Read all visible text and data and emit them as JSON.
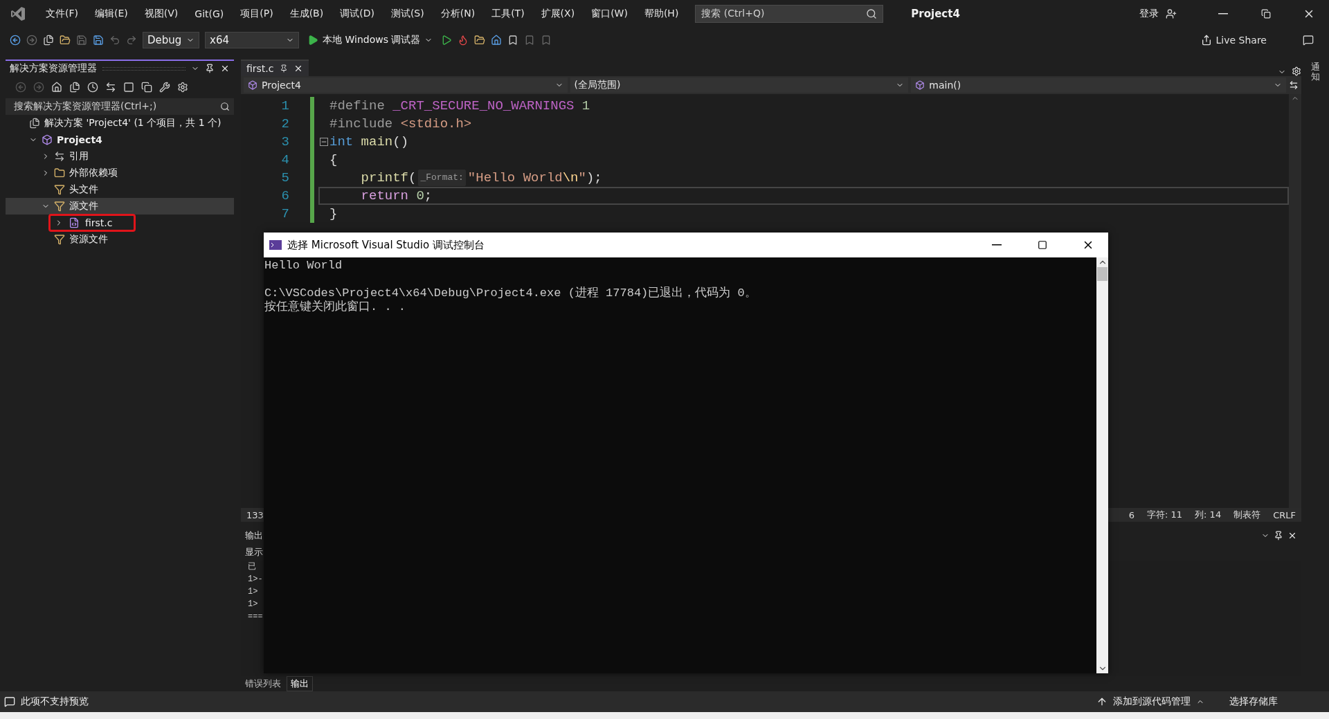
{
  "menu": [
    "文件(F)",
    "编辑(E)",
    "视图(V)",
    "Git(G)",
    "项目(P)",
    "生成(B)",
    "调试(D)",
    "测试(S)",
    "分析(N)",
    "工具(T)",
    "扩展(X)",
    "窗口(W)",
    "帮助(H)"
  ],
  "search": {
    "placeholder": "搜索 (Ctrl+Q)"
  },
  "window": {
    "title": "Project4"
  },
  "account": {
    "label": "登录"
  },
  "toolbar": {
    "configuration": "Debug",
    "platform": "x64",
    "run_label": "本地 Windows 调试器",
    "live_share": "Live Share"
  },
  "solution_explorer": {
    "title": "解决方案资源管理器",
    "search_placeholder": "搜索解决方案资源管理器(Ctrl+;)",
    "tree": [
      {
        "label": "解决方案 'Project4' (1 个项目，共 1 个)",
        "kind": "solution",
        "expandable": false,
        "selected": false,
        "annotated": false,
        "children": [
          {
            "label": "Project4",
            "kind": "project",
            "expandable": true,
            "expanded": true,
            "selected": false,
            "annotated": false,
            "children": [
              {
                "label": "引用",
                "kind": "references",
                "expandable": true,
                "expanded": false,
                "selected": false,
                "annotated": false
              },
              {
                "label": "外部依赖项",
                "kind": "dependencies",
                "expandable": true,
                "expanded": false,
                "selected": false,
                "annotated": false
              },
              {
                "label": "头文件",
                "kind": "filter",
                "expandable": false,
                "selected": false,
                "annotated": false
              },
              {
                "label": "源文件",
                "kind": "filter",
                "expandable": true,
                "expanded": true,
                "selected": true,
                "annotated": false,
                "children": [
                  {
                    "label": "first.c",
                    "kind": "file",
                    "expandable": true,
                    "expanded": false,
                    "selected": false,
                    "annotated": true
                  }
                ]
              },
              {
                "label": "资源文件",
                "kind": "filter",
                "expandable": false,
                "selected": false,
                "annotated": false
              }
            ]
          }
        ]
      }
    ]
  },
  "editor": {
    "tabs": [
      {
        "label": "first.c",
        "selected": true
      }
    ],
    "nav": {
      "project": "Project4",
      "scope": "(全局范围)",
      "member": "main()"
    },
    "lines": [
      {
        "number": "1",
        "fold": false,
        "current": false,
        "tokens": [
          {
            "t": "#define ",
            "kind": "directive"
          },
          {
            "t": "_CRT_SECURE_NO_WARNINGS",
            "kind": "macro"
          },
          {
            "t": " 1",
            "kind": "number"
          }
        ]
      },
      {
        "number": "2",
        "fold": false,
        "current": false,
        "tokens": [
          {
            "t": "#include ",
            "kind": "directive"
          },
          {
            "t": "<stdio.h>",
            "kind": "string"
          }
        ]
      },
      {
        "number": "3",
        "fold": true,
        "current": false,
        "tokens": [
          {
            "t": "int",
            "kind": "keyword"
          },
          {
            "t": " main",
            "kind": "function"
          },
          {
            "t": "()",
            "kind": "plain"
          }
        ]
      },
      {
        "number": "4",
        "fold": false,
        "current": false,
        "tokens": [
          {
            "t": "{",
            "kind": "plain"
          }
        ]
      },
      {
        "number": "5",
        "fold": false,
        "current": false,
        "tokens": [
          {
            "t": "    printf",
            "kind": "function"
          },
          {
            "t": "(",
            "kind": "plain"
          },
          {
            "t": "_Format:",
            "kind": "hint"
          },
          {
            "t": "\"Hello World",
            "kind": "string"
          },
          {
            "t": "\\n",
            "kind": "escape"
          },
          {
            "t": "\"",
            "kind": "string"
          },
          {
            "t": ");",
            "kind": "plain"
          }
        ]
      },
      {
        "number": "6",
        "fold": false,
        "current": true,
        "tokens": [
          {
            "t": "    return",
            "kind": "control"
          },
          {
            "t": " 0",
            "kind": "number"
          },
          {
            "t": ";",
            "kind": "plain"
          }
        ]
      },
      {
        "number": "7",
        "fold": false,
        "current": false,
        "tokens": [
          {
            "t": "}",
            "kind": "plain"
          }
        ]
      }
    ],
    "status": {
      "zoom": "133",
      "line": "6",
      "char": "字符: 11",
      "col": "列: 14",
      "tabs": "制表符",
      "eol": "CRLF"
    }
  },
  "output": {
    "title": "输出",
    "show_label": "显示",
    "lines": [
      "已",
      "1>-",
      "1>",
      "1>",
      "==="
    ]
  },
  "bottom_tabs": [
    {
      "label": "错误列表",
      "selected": false
    },
    {
      "label": "输出",
      "selected": true
    }
  ],
  "notifications": {
    "label": "通知"
  },
  "console": {
    "title": "选择 Microsoft Visual Studio 调试控制台",
    "blocks": [
      [
        "Hello World"
      ],
      [
        "C:\\VSCodes\\Project4\\x64\\Debug\\Project4.exe (进程 17784)已退出，代码为 0。",
        "按任意键关闭此窗口. . ."
      ]
    ]
  },
  "status_bar": {
    "message": "此项不支持预览",
    "source_control": "添加到源代码管理",
    "repository": "选择存储库"
  }
}
